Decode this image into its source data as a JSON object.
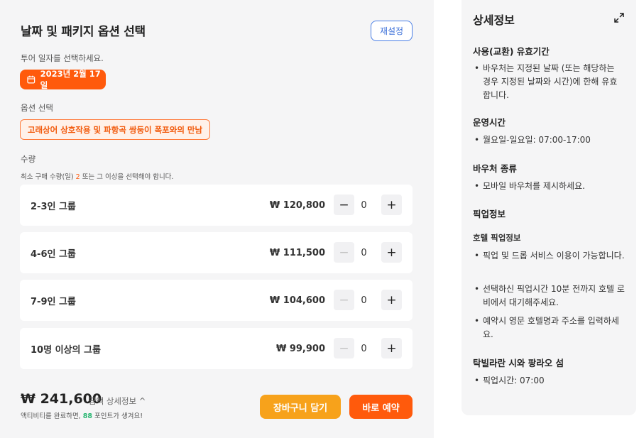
{
  "left": {
    "title": "날짜 및 패키지 옵션 선택",
    "reset_label": "재설정",
    "date_section_label": "투어 일자를 선택하세요.",
    "date_value": "2023년 2월 17일",
    "option_section_label": "옵션 선택",
    "option_value": "고래상어 상호작용 및 파항곡 쌍둥이 폭포와의 만남",
    "quantity_section_label": "수량",
    "min_note_before": "최소 구매 수량(일) ",
    "min_note_count": "2",
    "min_note_after": " 또는 그 이상을 선택해야 합니다.",
    "rows": [
      {
        "name": "2-3인 그룹",
        "price": "₩ 120,800",
        "qty": "0",
        "minus": "−",
        "plus": "+"
      },
      {
        "name": "4-6인 그룹",
        "price": "₩ 111,500",
        "qty": "0",
        "minus": "−",
        "plus": "+"
      },
      {
        "name": "7-9인 그룹",
        "price": "₩ 104,600",
        "qty": "0",
        "minus": "−",
        "plus": "+"
      },
      {
        "name": "10명 이상의 그룹",
        "price": "₩ 99,900",
        "qty": "0",
        "minus": "−",
        "plus": "+"
      }
    ],
    "total": "₩ 241,600",
    "total_detail": "금액 상세정보 ^",
    "points_before": "액티비티를 완료하면, ",
    "points_value": "88",
    "points_after": " 포인트가 생겨요!",
    "cart_label": "장바구니 담기",
    "book_label": "바로 예약"
  },
  "right": {
    "title": "상세정보",
    "validity_heading": "사용(교환) 유효기간",
    "validity_items": [
      "바우처는 지정된 날짜 (또는 해당하는 경우 지정된 날짜와 시간)에 한해 유효합니다."
    ],
    "hours_heading": "운영시간",
    "hours_items": [
      "월요일-일요일: 07:00-17:00"
    ],
    "voucher_heading": "바우처 종류",
    "voucher_items": [
      "모바일 바우처를 제시하세요."
    ],
    "pickup_heading": "픽업정보",
    "hotel_pickup_subheading": "호텔 픽업정보",
    "hotel_pickup_items": [
      "픽업 및 드롭 서비스 이용이 가능합니다.",
      "선택하신 픽업시간 10분 전까지 호텔 로비에서 대기해주세요.",
      "예약시 영문 호텔명과 주소를 입력하세요."
    ],
    "area_heading": "탁빌라란 시와 팡라오 섬",
    "area_items": [
      "픽업시간: 07:00"
    ]
  },
  "icons": {
    "date": "calendar-icon",
    "expand": "expand-icon"
  },
  "colors": {
    "accent_orange": "#ff5a0c",
    "cart_yellow": "#f7a21b",
    "reset_blue": "#3b6fd9",
    "points_green": "#2bb673"
  }
}
